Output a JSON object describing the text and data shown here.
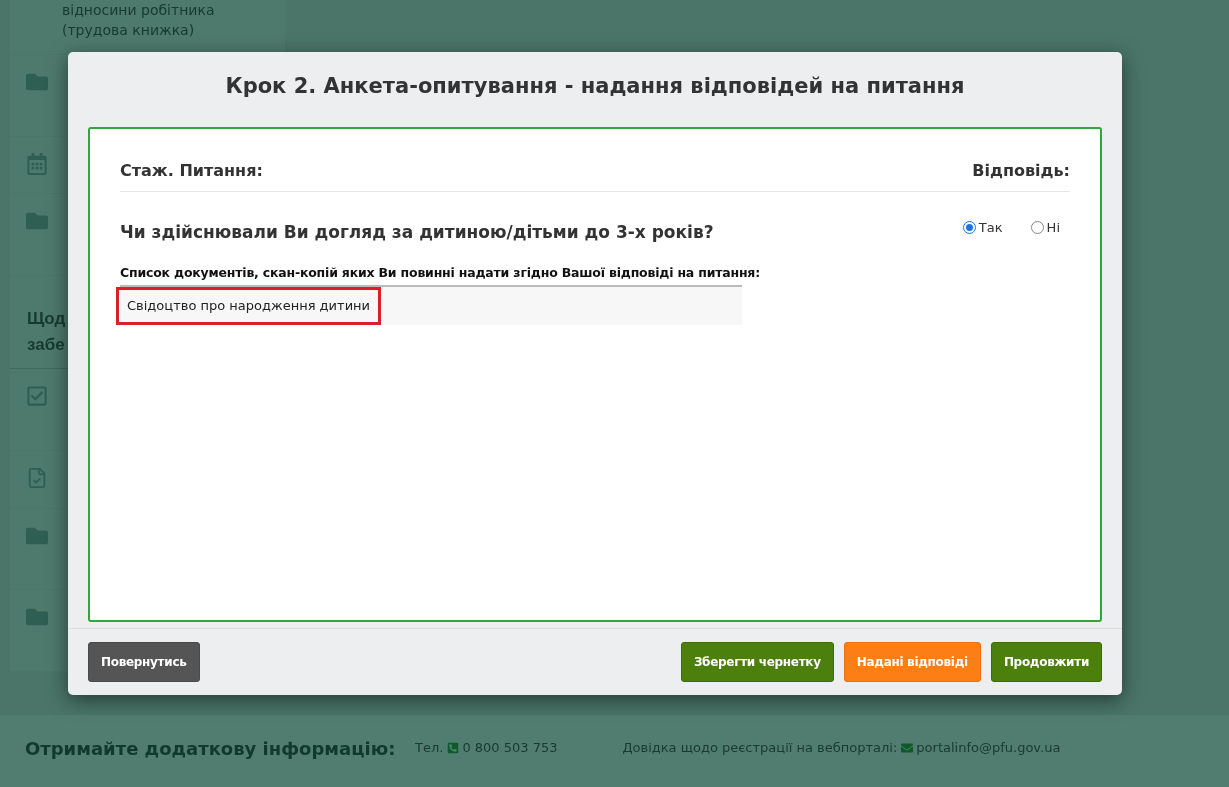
{
  "sidebar": {
    "items": [
      {
        "kind": "text",
        "lines": [
          "відносини робітника",
          "(трудова книжка)"
        ]
      },
      {
        "kind": "folder"
      },
      {
        "kind": "calendar"
      },
      {
        "kind": "folder"
      },
      {
        "kind": "heading",
        "lines": [
          "Щод",
          "забе"
        ]
      },
      {
        "kind": "checkbox"
      },
      {
        "kind": "doc-check"
      },
      {
        "kind": "folder"
      },
      {
        "kind": "folder"
      }
    ]
  },
  "modal": {
    "title": "Крок 2. Анкета-опитування - надання відповідей на питання",
    "header": {
      "left": "Стаж. Питання:",
      "right": "Відповідь:"
    },
    "question": {
      "text": "Чи здійснювали Ви догляд за дитиною/дітьми до 3-х років?",
      "options": [
        {
          "label": "Так",
          "selected": true
        },
        {
          "label": "Ні",
          "selected": false
        }
      ]
    },
    "documents": {
      "label": "Список документів, скан-копій яких Ви повинні надати згідно Вашої відповіді на питання:",
      "items": [
        {
          "text": "Свідоцтво про народження дитини",
          "highlighted": true
        }
      ]
    },
    "buttons": [
      {
        "label": "Повернутись",
        "kind": "secondary"
      },
      {
        "label": "Зберегти чернетку",
        "kind": "success"
      },
      {
        "label": "Надані відповіді",
        "kind": "warning"
      },
      {
        "label": "Продовжити",
        "kind": "success"
      }
    ]
  },
  "footer": {
    "title": "Отримайте додаткову інформацію:",
    "phone_label": "Тел.",
    "phone": "0 800 503 753",
    "help_label": "Довідка щодо реєстрації на вебпорталі:",
    "email": "portalinfo@pfu.gov.ua"
  }
}
